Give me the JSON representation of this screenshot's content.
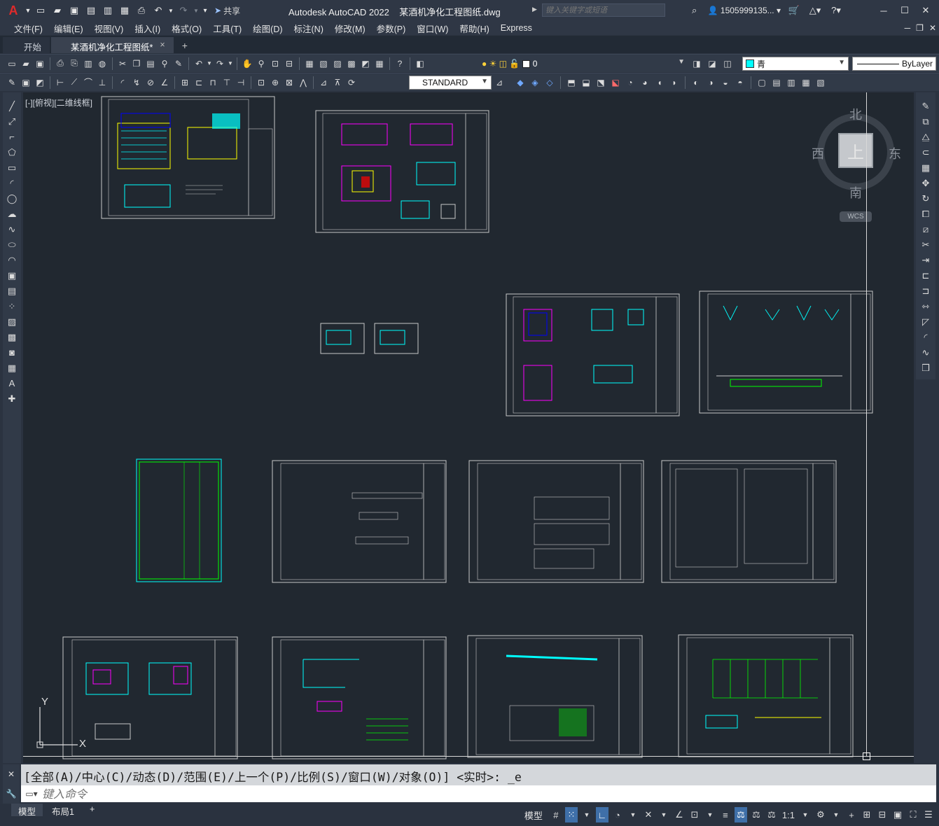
{
  "app": {
    "title": "Autodesk AutoCAD 2022",
    "filename": "某酒机净化工程图纸.dwg",
    "search_placeholder": "键入关键字或短语",
    "user": "1505999135...",
    "share_label": "共享"
  },
  "menu": [
    "文件(F)",
    "编辑(E)",
    "视图(V)",
    "插入(I)",
    "格式(O)",
    "工具(T)",
    "绘图(D)",
    "标注(N)",
    "修改(M)",
    "参数(P)",
    "窗口(W)",
    "帮助(H)",
    "Express"
  ],
  "tabs": {
    "start": "开始",
    "active": "某酒机净化工程图纸*",
    "close": "×",
    "add": "+"
  },
  "toolbar": {
    "layer_value": "0",
    "color_value": "青",
    "linetype_value": "ByLayer",
    "textstyle_value": "STANDARD"
  },
  "viewport": {
    "label": "[-][俯视][二维线框]"
  },
  "viewcube": {
    "north": "北",
    "south": "南",
    "east": "东",
    "west": "西",
    "face": "上",
    "wcs": "WCS"
  },
  "ucs": {
    "x": "X",
    "y": "Y"
  },
  "command": {
    "history": "[全部(A)/中心(C)/动态(D)/范围(E)/上一个(P)/比例(S)/窗口(W)/对象(O)] <实时>: _e",
    "placeholder": "键入命令"
  },
  "status": {
    "model_tab": "模型",
    "layout_tab": "布局1",
    "add_tab": "+",
    "model_label": "模型",
    "scale": "1:1"
  },
  "colors": {
    "canvas": "#212830",
    "cyan": "#00ffff",
    "magenta": "#ff00ff",
    "yellow": "#ffff00",
    "green": "#00ff00",
    "frame": "#c8c8c8"
  }
}
